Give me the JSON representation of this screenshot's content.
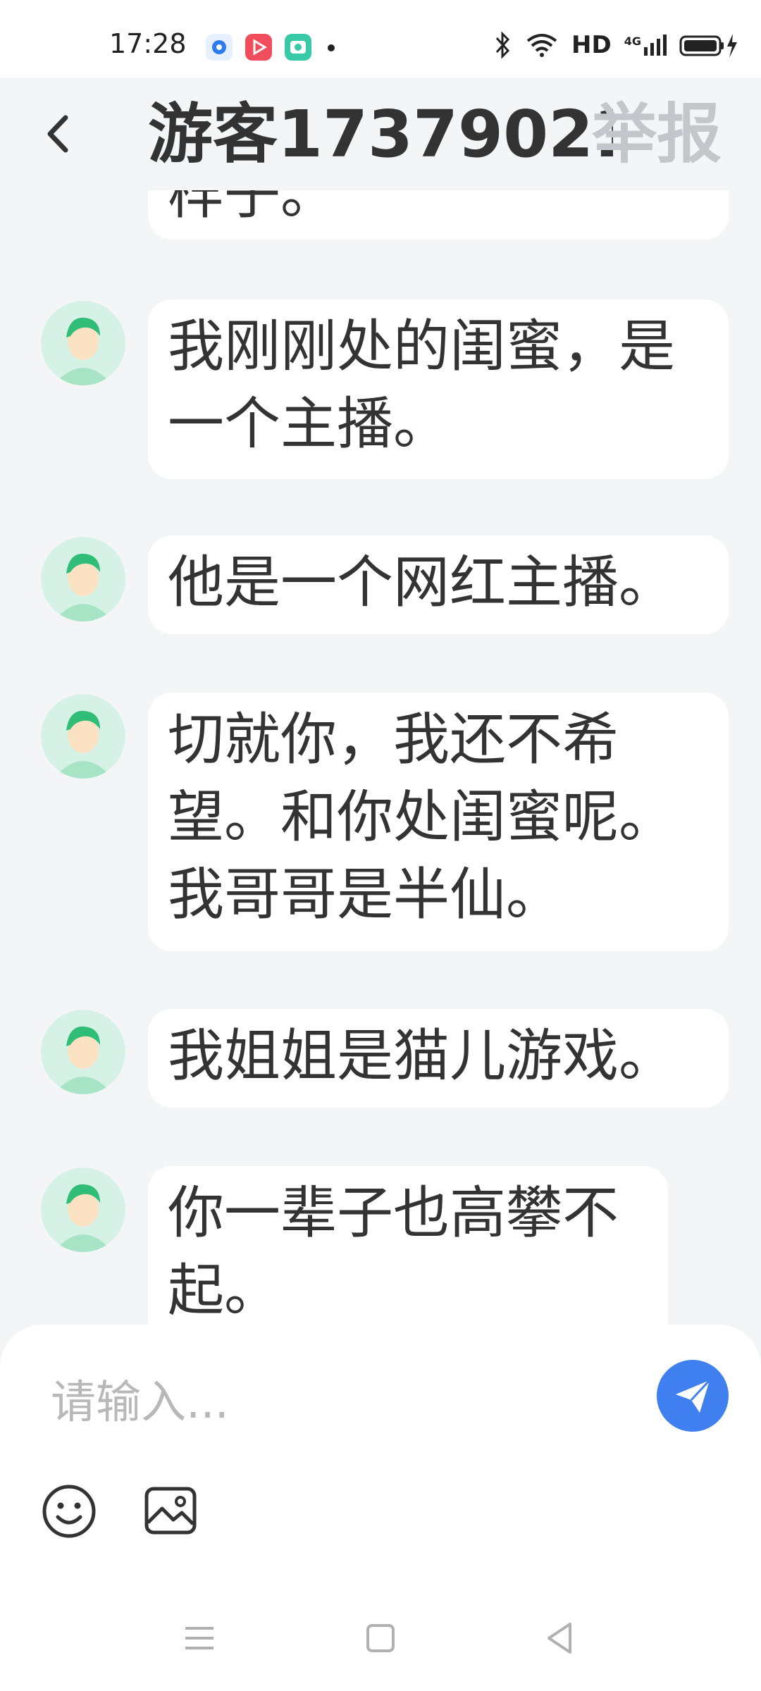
{
  "status_bar": {
    "time": "17:28",
    "network": "HD",
    "signal": "4G",
    "icons": [
      "app-blue-circle-icon",
      "app-red-play-icon",
      "app-green-camera-icon",
      "bluetooth-icon",
      "wifi-icon",
      "battery-charging-icon"
    ]
  },
  "header": {
    "title": "游客17379021",
    "report_label": "举报",
    "back_icon": "chevron-left-icon"
  },
  "messages": [
    {
      "text": "样子。"
    },
    {
      "text": "我刚刚处的闺蜜，是一个主播。"
    },
    {
      "text": "他是一个网红主播。"
    },
    {
      "text": "切就你，我还不希望。和你处闺蜜呢。我哥哥是半仙。"
    },
    {
      "text": "我姐姐是猫儿游戏。"
    },
    {
      "text": "你一辈子也高攀不起。"
    }
  ],
  "input": {
    "placeholder": "请输入..."
  },
  "tools": [
    "emoji-icon",
    "image-icon"
  ],
  "navigation": [
    "menu-icon",
    "home-square-icon",
    "back-triangle-icon"
  ],
  "colors": {
    "accent": "#3f7ff0",
    "background": "#f4f5f7",
    "avatar_bg": "#d6f1e6",
    "avatar_hair": "#2fbd77"
  }
}
